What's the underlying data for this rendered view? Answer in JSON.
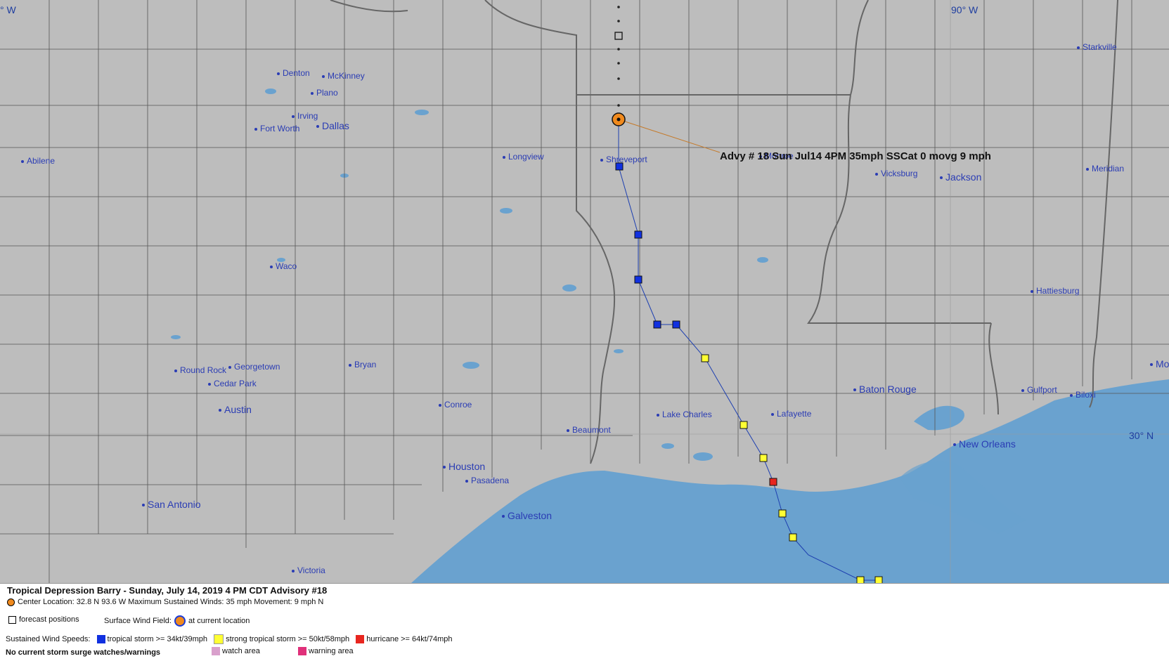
{
  "map": {
    "coords": {
      "lon_90": "90° W",
      "lat_30": "30° N",
      "lon_left": "° W"
    },
    "cities": [
      {
        "name": "Denton",
        "big": false
      },
      {
        "name": "McKinney",
        "big": false
      },
      {
        "name": "Plano",
        "big": false
      },
      {
        "name": "Irving",
        "big": false
      },
      {
        "name": "Fort Worth",
        "big": false
      },
      {
        "name": "Dallas",
        "big": true
      },
      {
        "name": "Abilene",
        "big": false
      },
      {
        "name": "Longview",
        "big": false
      },
      {
        "name": "Shreveport",
        "big": false
      },
      {
        "name": "Monroe",
        "big": false
      },
      {
        "name": "Vicksburg",
        "big": false
      },
      {
        "name": "Jackson",
        "big": true
      },
      {
        "name": "Meridian",
        "big": false
      },
      {
        "name": "Starkville",
        "big": false
      },
      {
        "name": "Waco",
        "big": false
      },
      {
        "name": "Hattiesburg",
        "big": false
      },
      {
        "name": "Round Rock",
        "big": false
      },
      {
        "name": "Georgetown",
        "big": false
      },
      {
        "name": "Cedar Park",
        "big": false
      },
      {
        "name": "Bryan",
        "big": false
      },
      {
        "name": "Austin",
        "big": true
      },
      {
        "name": "Conroe",
        "big": false
      },
      {
        "name": "Baton Rouge",
        "big": true
      },
      {
        "name": "Lake Charles",
        "big": false
      },
      {
        "name": "Lafayette",
        "big": false
      },
      {
        "name": "Gulfport",
        "big": false
      },
      {
        "name": "Biloxi",
        "big": false
      },
      {
        "name": "Beaumont",
        "big": false
      },
      {
        "name": "Houston",
        "big": true
      },
      {
        "name": "Pasadena",
        "big": false
      },
      {
        "name": "New Orleans",
        "big": true
      },
      {
        "name": "San Antonio",
        "big": true
      },
      {
        "name": "Galveston",
        "big": true
      },
      {
        "name": "Victoria",
        "big": false
      },
      {
        "name": "Mo",
        "big": true
      }
    ],
    "advisory_label": "Advy # 18 Sun Jul14 4PM  35mph SSCat 0 movg 9 mph"
  },
  "legend": {
    "title": "Tropical Depression Barry  -  Sunday, July 14, 2019  4 PM CDT   Advisory #18",
    "center_line": "Center Location: 32.8 N  93.6 W   Maximum Sustained Winds: 35 mph  Movement: 9 mph N",
    "forecast_positions": "forecast positions",
    "surface_wind_field": "Surface Wind Field:",
    "at_current_location": "at current location",
    "sustained_label": "Sustained Wind Speeds:",
    "ts_label": "tropical storm >= 34kt/39mph",
    "sts_label": "strong tropical storm >= 50kt/58mph",
    "hu_label": "hurricane >= 64kt/74mph",
    "no_surge": "No current storm surge watches/warnings",
    "watch_area": "watch area",
    "warning_area": "warning area"
  },
  "colors": {
    "tropical_storm": "#1030e0",
    "strong_tropical_storm": "#ffff33",
    "hurricane": "#e8261f",
    "watch": "#d9a0cc",
    "warning": "#e0307a",
    "water": "#6aa2cf",
    "land": "#bdbdbd",
    "storm_center": "#f08a1e"
  }
}
